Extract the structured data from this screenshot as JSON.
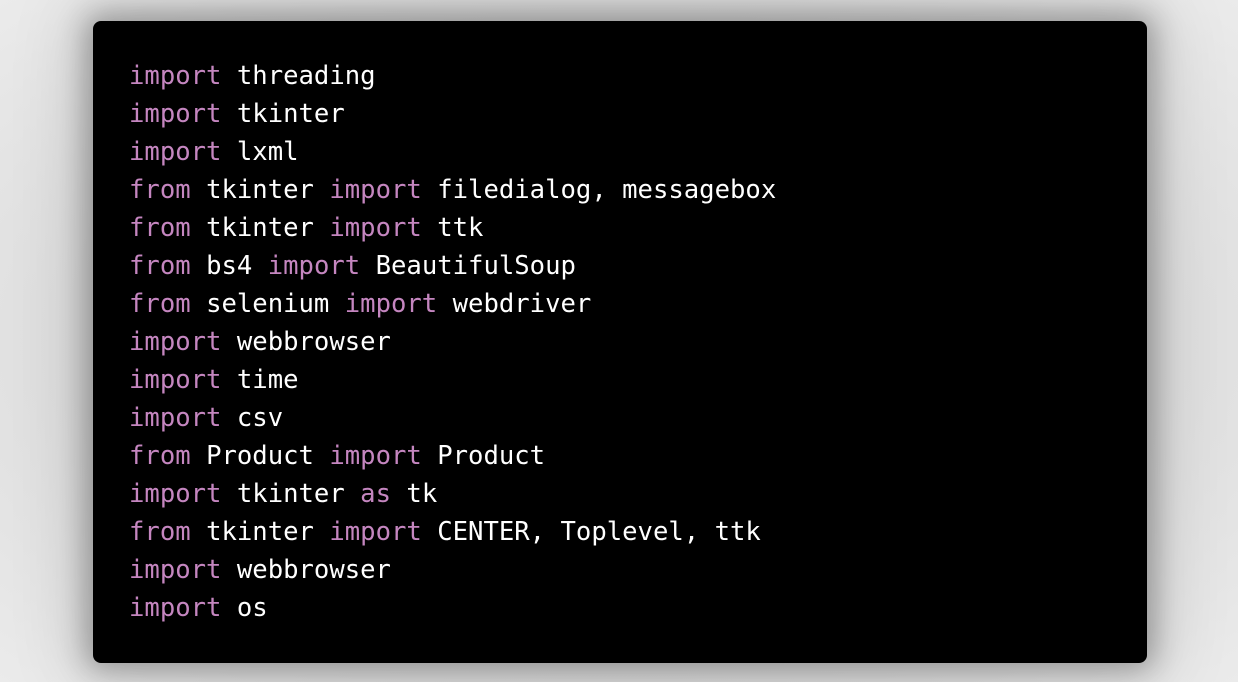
{
  "colors": {
    "page_background": "#dcdcdc",
    "card_background": "#000000",
    "keyword": "#c586c0",
    "identifier": "#ffffff"
  },
  "code": {
    "language": "python",
    "lines": [
      [
        {
          "t": "kw",
          "v": "import"
        },
        {
          "t": "sp",
          "v": " "
        },
        {
          "t": "id",
          "v": "threading"
        }
      ],
      [
        {
          "t": "kw",
          "v": "import"
        },
        {
          "t": "sp",
          "v": " "
        },
        {
          "t": "id",
          "v": "tkinter"
        }
      ],
      [
        {
          "t": "kw",
          "v": "import"
        },
        {
          "t": "sp",
          "v": " "
        },
        {
          "t": "id",
          "v": "lxml"
        }
      ],
      [
        {
          "t": "kw",
          "v": "from"
        },
        {
          "t": "sp",
          "v": " "
        },
        {
          "t": "id",
          "v": "tkinter"
        },
        {
          "t": "sp",
          "v": " "
        },
        {
          "t": "kw",
          "v": "import"
        },
        {
          "t": "sp",
          "v": " "
        },
        {
          "t": "id",
          "v": "filedialog, messagebox"
        }
      ],
      [
        {
          "t": "kw",
          "v": "from"
        },
        {
          "t": "sp",
          "v": " "
        },
        {
          "t": "id",
          "v": "tkinter"
        },
        {
          "t": "sp",
          "v": " "
        },
        {
          "t": "kw",
          "v": "import"
        },
        {
          "t": "sp",
          "v": " "
        },
        {
          "t": "id",
          "v": "ttk"
        }
      ],
      [
        {
          "t": "kw",
          "v": "from"
        },
        {
          "t": "sp",
          "v": " "
        },
        {
          "t": "id",
          "v": "bs4"
        },
        {
          "t": "sp",
          "v": " "
        },
        {
          "t": "kw",
          "v": "import"
        },
        {
          "t": "sp",
          "v": " "
        },
        {
          "t": "id",
          "v": "BeautifulSoup"
        }
      ],
      [
        {
          "t": "kw",
          "v": "from"
        },
        {
          "t": "sp",
          "v": " "
        },
        {
          "t": "id",
          "v": "selenium"
        },
        {
          "t": "sp",
          "v": " "
        },
        {
          "t": "kw",
          "v": "import"
        },
        {
          "t": "sp",
          "v": " "
        },
        {
          "t": "id",
          "v": "webdriver"
        }
      ],
      [
        {
          "t": "kw",
          "v": "import"
        },
        {
          "t": "sp",
          "v": " "
        },
        {
          "t": "id",
          "v": "webbrowser"
        }
      ],
      [
        {
          "t": "kw",
          "v": "import"
        },
        {
          "t": "sp",
          "v": " "
        },
        {
          "t": "id",
          "v": "time"
        }
      ],
      [
        {
          "t": "kw",
          "v": "import"
        },
        {
          "t": "sp",
          "v": " "
        },
        {
          "t": "id",
          "v": "csv"
        }
      ],
      [
        {
          "t": "kw",
          "v": "from"
        },
        {
          "t": "sp",
          "v": " "
        },
        {
          "t": "id",
          "v": "Product"
        },
        {
          "t": "sp",
          "v": " "
        },
        {
          "t": "kw",
          "v": "import"
        },
        {
          "t": "sp",
          "v": " "
        },
        {
          "t": "id",
          "v": "Product"
        }
      ],
      [
        {
          "t": "kw",
          "v": "import"
        },
        {
          "t": "sp",
          "v": " "
        },
        {
          "t": "id",
          "v": "tkinter"
        },
        {
          "t": "sp",
          "v": " "
        },
        {
          "t": "kw",
          "v": "as"
        },
        {
          "t": "sp",
          "v": " "
        },
        {
          "t": "id",
          "v": "tk"
        }
      ],
      [
        {
          "t": "kw",
          "v": "from"
        },
        {
          "t": "sp",
          "v": " "
        },
        {
          "t": "id",
          "v": "tkinter"
        },
        {
          "t": "sp",
          "v": " "
        },
        {
          "t": "kw",
          "v": "import"
        },
        {
          "t": "sp",
          "v": " "
        },
        {
          "t": "id",
          "v": "CENTER, Toplevel, ttk"
        }
      ],
      [
        {
          "t": "kw",
          "v": "import"
        },
        {
          "t": "sp",
          "v": " "
        },
        {
          "t": "id",
          "v": "webbrowser"
        }
      ],
      [
        {
          "t": "kw",
          "v": "import"
        },
        {
          "t": "sp",
          "v": " "
        },
        {
          "t": "id",
          "v": "os"
        }
      ]
    ]
  }
}
